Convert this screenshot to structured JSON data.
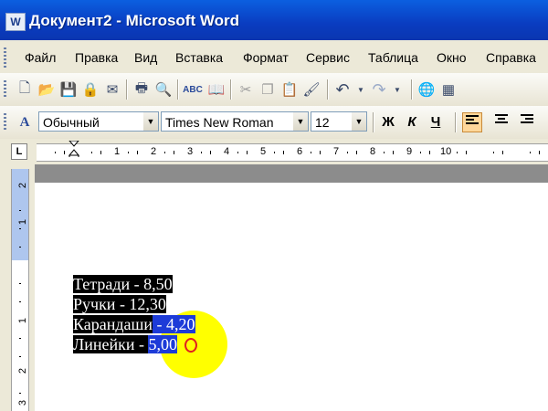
{
  "window": {
    "title": "Документ2 - Microsoft Word",
    "app_icon": "word-doc-icon",
    "app_icon_glyph": "W"
  },
  "menu": [
    "Файл",
    "Правка",
    "Вид",
    "Вставка",
    "Формат",
    "Сервис",
    "Таблица",
    "Окно",
    "Справка"
  ],
  "standard_toolbar": {
    "buttons": [
      "new-icon",
      "open-icon",
      "save-icon",
      "permission-icon",
      "email-icon",
      "print-icon",
      "print-preview-icon",
      "spelling-icon",
      "research-icon",
      "cut-icon",
      "copy-icon",
      "paste-icon",
      "format-painter-icon",
      "undo-icon",
      "redo-icon",
      "hyperlink-icon",
      "tables-borders-icon"
    ],
    "glyphs": {
      "new": "🗋",
      "open": "📂",
      "save": "💾",
      "permission": "🔒",
      "email": "✉",
      "print": "🖶",
      "print_preview": "🔍",
      "spelling": "ABC",
      "research": "📖",
      "cut": "✂",
      "copy": "❐",
      "paste": "📋",
      "format_painter": "🖌",
      "undo": "↶",
      "redo": "↷",
      "hyperlink": "🌐",
      "tables": "▦"
    }
  },
  "formatting_toolbar": {
    "style_value": "Обычный",
    "font_value": "Times New Roman",
    "size_value": "12",
    "bold_label": "Ж",
    "italic_label": "К",
    "underline_label": "Ч",
    "styles_glyph": "A"
  },
  "ruler": {
    "tab_selector": "L",
    "numbers": [
      "1",
      "2",
      "3",
      "4",
      "5",
      "6",
      "7",
      "8",
      "9",
      "10"
    ],
    "vertical_numbers": [
      "2",
      "1",
      "1",
      "2",
      "3"
    ]
  },
  "document": {
    "lines": [
      {
        "part1": "Тетради - 8,50",
        "part2": ""
      },
      {
        "part1": "Ручки  - 12,30",
        "part2": ""
      },
      {
        "part1": "Карандаши",
        "part2": " - 4,20"
      },
      {
        "part1": "Линейки - ",
        "part2": "5,00"
      }
    ]
  },
  "colors": {
    "selection_black": "#000000",
    "selection_blue": "#1d3bd8",
    "cursor_highlight": "#ffff00"
  }
}
